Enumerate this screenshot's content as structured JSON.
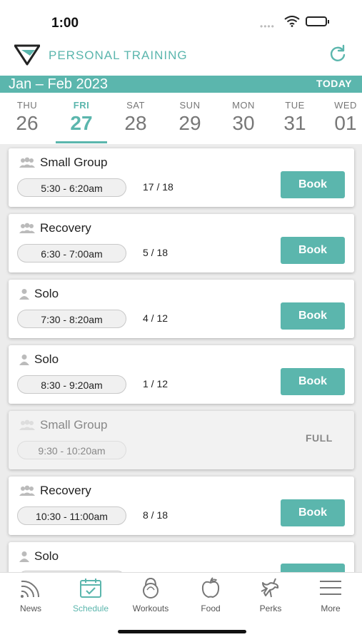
{
  "status": {
    "time": "1:00",
    "signal_dots": "••••"
  },
  "header": {
    "title": "PERSONAL TRAINING"
  },
  "calendar": {
    "month": "Jan – Feb 2023",
    "today_label": "TODAY",
    "days": [
      {
        "dow": "THU",
        "num": "26"
      },
      {
        "dow": "FRI",
        "num": "27"
      },
      {
        "dow": "SAT",
        "num": "28"
      },
      {
        "dow": "SUN",
        "num": "29"
      },
      {
        "dow": "MON",
        "num": "30"
      },
      {
        "dow": "TUE",
        "num": "31"
      },
      {
        "dow": "WED",
        "num": "01"
      }
    ]
  },
  "sessions": [
    {
      "title": "Small Group",
      "time": "5:30 - 6:20am",
      "count": "17 / 18",
      "action": "Book"
    },
    {
      "title": "Recovery",
      "time": "6:30 - 7:00am",
      "count": "5 / 18",
      "action": "Book"
    },
    {
      "title": "Solo",
      "time": "7:30 - 8:20am",
      "count": "4 / 12",
      "action": "Book"
    },
    {
      "title": "Solo",
      "time": "8:30 - 9:20am",
      "count": "1 / 12",
      "action": "Book"
    },
    {
      "title": "Small Group",
      "time": "9:30 - 10:20am",
      "status": "FULL"
    },
    {
      "title": "Recovery",
      "time": "10:30 - 11:00am",
      "count": "8 / 18",
      "action": "Book"
    },
    {
      "title": "Solo"
    }
  ],
  "tabs": [
    {
      "label": "News",
      "icon": "news-icon"
    },
    {
      "label": "Schedule",
      "icon": "calendar-check-icon"
    },
    {
      "label": "Workouts",
      "icon": "kettlebell-icon"
    },
    {
      "label": "Food",
      "icon": "apple-icon"
    },
    {
      "label": "Perks",
      "icon": "unicorn-icon"
    },
    {
      "label": "More",
      "icon": "menu-icon"
    }
  ],
  "colors": {
    "accent": "#5bb6ad"
  }
}
